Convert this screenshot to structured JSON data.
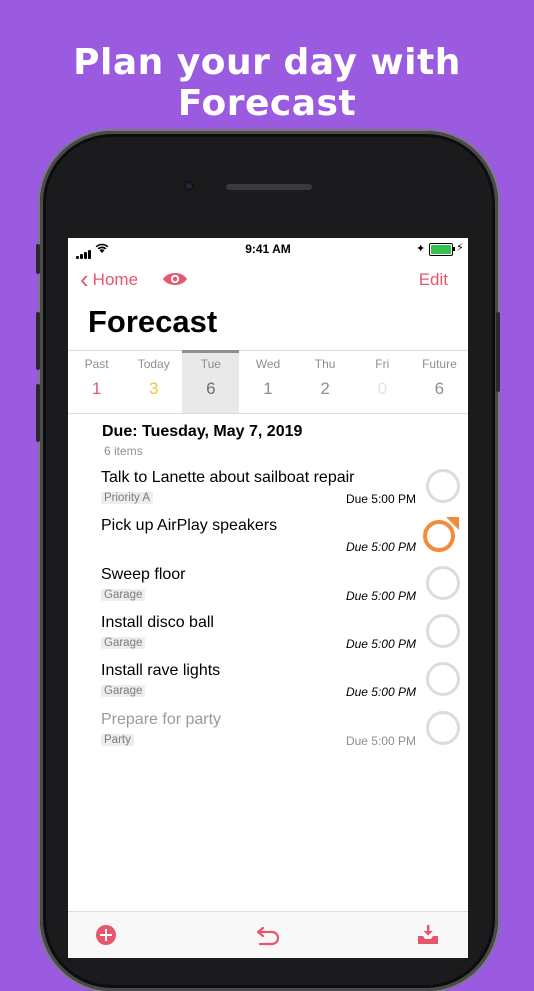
{
  "headline": "Plan your day with Forecast",
  "status_bar": {
    "time": "9:41 AM"
  },
  "nav": {
    "back_label": "Home",
    "edit_label": "Edit"
  },
  "large_title": "Forecast",
  "tabs": [
    {
      "label": "Past",
      "count": "1",
      "color": "#e8566e"
    },
    {
      "label": "Today",
      "count": "3",
      "color": "#f0c733"
    },
    {
      "label": "Tue",
      "count": "6",
      "color": "#6e6e73",
      "active": true
    },
    {
      "label": "Wed",
      "count": "1",
      "color": "#8e8e93"
    },
    {
      "label": "Thu",
      "count": "2",
      "color": "#8e8e93"
    },
    {
      "label": "Fri",
      "count": "0",
      "color": "#e3e3e6"
    },
    {
      "label": "Future",
      "count": "6",
      "color": "#8e8e93"
    }
  ],
  "section": {
    "title": "Due: Tuesday, May 7, 2019",
    "count": "6 items"
  },
  "tasks": [
    {
      "title": "Talk to Lanette about sailboat repair",
      "tag": "Priority A",
      "due": "Due 5:00 PM",
      "italic": false,
      "state": "open"
    },
    {
      "title": "Pick up AirPlay speakers",
      "tag": "",
      "due": "Due 5:00 PM",
      "italic": true,
      "state": "flagged"
    },
    {
      "title": "Sweep floor",
      "tag": "Garage",
      "due": "Due 5:00 PM",
      "italic": true,
      "state": "open"
    },
    {
      "title": "Install disco ball",
      "tag": "Garage",
      "due": "Due 5:00 PM",
      "italic": true,
      "state": "open"
    },
    {
      "title": "Install rave lights",
      "tag": "Garage",
      "due": "Due 5:00 PM",
      "italic": true,
      "state": "open"
    },
    {
      "title": "Prepare for party",
      "tag": "Party",
      "due": "Due 5:00 PM",
      "italic": false,
      "state": "dim"
    }
  ],
  "colors": {
    "accent": "#e8566e",
    "background": "#9b5be0",
    "flag": "#f28b3c"
  },
  "icons": [
    "back-chevron-icon",
    "eye-icon",
    "add-circle-icon",
    "undo-icon",
    "inbox-download-icon"
  ]
}
